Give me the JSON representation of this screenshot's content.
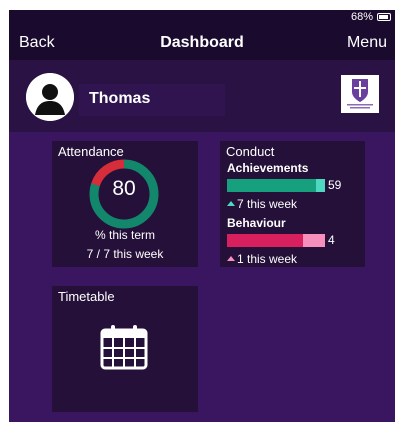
{
  "status": {
    "battery_text": "68%"
  },
  "nav": {
    "back": "Back",
    "title": "Dashboard",
    "menu": "Menu"
  },
  "profile": {
    "name": "Thomas",
    "avatar_icon": "person-silhouette-icon",
    "logo_icon": "school-crest-icon"
  },
  "attendance": {
    "title": "Attendance",
    "value": "80",
    "percent": 80,
    "this_term": "% this term",
    "this_week": "7 / 7 this week"
  },
  "conduct": {
    "title": "Conduct",
    "achievements": {
      "label": "Achievements",
      "value": "59",
      "week": "7 this week"
    },
    "behaviour": {
      "label": "Behaviour",
      "value": "4",
      "week": "1 this week"
    }
  },
  "timetable": {
    "title": "Timetable",
    "icon": "calendar-icon"
  },
  "colors": {
    "background": "#3a1660",
    "header": "#1a0b2e",
    "tile": "#241038",
    "attendance_good": "#13876b",
    "attendance_missed": "#d62d3a",
    "achievement": "#17a07e",
    "achievement_tip": "#4fd8c0",
    "behaviour": "#d9205f",
    "behaviour_tip": "#f78fbd"
  }
}
